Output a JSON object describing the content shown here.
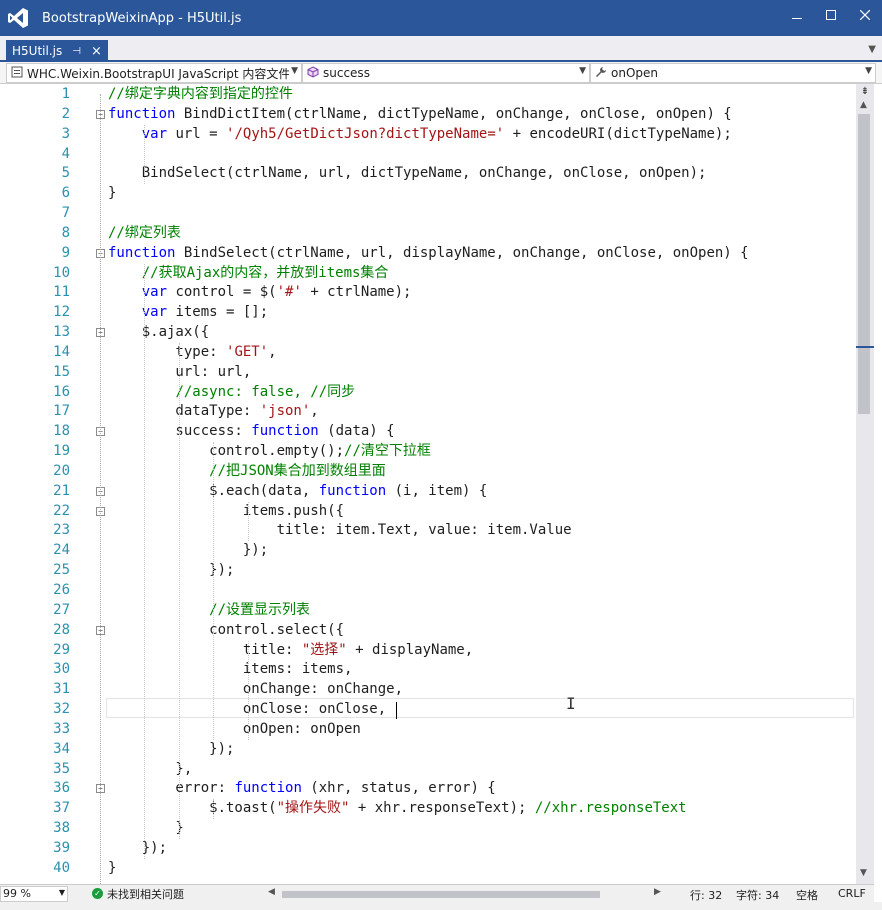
{
  "window": {
    "title": "BootstrapWeixinApp - H5Util.js",
    "colors": {
      "titlebar": "#2b579a",
      "keyword": "#0000ff",
      "string": "#a31515",
      "comment": "#008000",
      "linenum": "#2b91af"
    }
  },
  "tab": {
    "label": "H5Util.js",
    "pin_glyph": "⊣",
    "close_glyph": "×"
  },
  "nav": {
    "project": "WHC.Weixin.BootstrapUI JavaScript 内容文件",
    "scope": "success",
    "member": "onOpen"
  },
  "code_lines": [
    [
      {
        "t": "//绑定字典内容到指定的控件",
        "c": "cm"
      }
    ],
    [
      {
        "t": "function",
        "c": "kw"
      },
      {
        "t": " BindDictItem(ctrlName, dictTypeName, onChange, onClose, onOpen) {",
        "c": ""
      }
    ],
    [
      {
        "t": "    ",
        "c": ""
      },
      {
        "t": "var",
        "c": "kw"
      },
      {
        "t": " url = ",
        "c": ""
      },
      {
        "t": "'/Qyh5/GetDictJson?dictTypeName='",
        "c": "str"
      },
      {
        "t": " + encodeURI(dictTypeName);",
        "c": ""
      }
    ],
    [],
    [
      {
        "t": "    BindSelect(ctrlName, url, dictTypeName, onChange, onClose, onOpen);",
        "c": ""
      }
    ],
    [
      {
        "t": "}",
        "c": ""
      }
    ],
    [],
    [
      {
        "t": "//绑定列表",
        "c": "cm"
      }
    ],
    [
      {
        "t": "function",
        "c": "kw"
      },
      {
        "t": " BindSelect(ctrlName, url, displayName, onChange, onClose, onOpen) {",
        "c": ""
      }
    ],
    [
      {
        "t": "    ",
        "c": ""
      },
      {
        "t": "//获取Ajax的内容，并放到items集合",
        "c": "cm"
      }
    ],
    [
      {
        "t": "    ",
        "c": ""
      },
      {
        "t": "var",
        "c": "kw"
      },
      {
        "t": " control = $(",
        "c": ""
      },
      {
        "t": "'#'",
        "c": "str"
      },
      {
        "t": " + ctrlName);",
        "c": ""
      }
    ],
    [
      {
        "t": "    ",
        "c": ""
      },
      {
        "t": "var",
        "c": "kw"
      },
      {
        "t": " items = [];",
        "c": ""
      }
    ],
    [
      {
        "t": "    $.ajax({",
        "c": ""
      }
    ],
    [
      {
        "t": "        type: ",
        "c": ""
      },
      {
        "t": "'GET'",
        "c": "str"
      },
      {
        "t": ",",
        "c": ""
      }
    ],
    [
      {
        "t": "        url: url,",
        "c": ""
      }
    ],
    [
      {
        "t": "        ",
        "c": ""
      },
      {
        "t": "//async: false, //同步",
        "c": "cm"
      }
    ],
    [
      {
        "t": "        dataType: ",
        "c": ""
      },
      {
        "t": "'json'",
        "c": "str"
      },
      {
        "t": ",",
        "c": ""
      }
    ],
    [
      {
        "t": "        success: ",
        "c": ""
      },
      {
        "t": "function",
        "c": "kw"
      },
      {
        "t": " (data) {",
        "c": ""
      }
    ],
    [
      {
        "t": "            control.empty();",
        "c": ""
      },
      {
        "t": "//清空下拉框",
        "c": "cm"
      }
    ],
    [
      {
        "t": "            ",
        "c": ""
      },
      {
        "t": "//把JSON集合加到数组里面",
        "c": "cm"
      }
    ],
    [
      {
        "t": "            $.each(data, ",
        "c": ""
      },
      {
        "t": "function",
        "c": "kw"
      },
      {
        "t": " (i, item) {",
        "c": ""
      }
    ],
    [
      {
        "t": "                items.push({",
        "c": ""
      }
    ],
    [
      {
        "t": "                    title: item.Text, value: item.Value",
        "c": ""
      }
    ],
    [
      {
        "t": "                });",
        "c": ""
      }
    ],
    [
      {
        "t": "            });",
        "c": ""
      }
    ],
    [],
    [
      {
        "t": "            ",
        "c": ""
      },
      {
        "t": "//设置显示列表",
        "c": "cm"
      }
    ],
    [
      {
        "t": "            control.select({",
        "c": ""
      }
    ],
    [
      {
        "t": "                title: ",
        "c": ""
      },
      {
        "t": "\"选择\"",
        "c": "str"
      },
      {
        "t": " + displayName,",
        "c": ""
      }
    ],
    [
      {
        "t": "                items: items,",
        "c": ""
      }
    ],
    [
      {
        "t": "                onChange: onChange,",
        "c": ""
      }
    ],
    [
      {
        "t": "                onClose: onClose,",
        "c": ""
      }
    ],
    [
      {
        "t": "                onOpen: onOpen",
        "c": ""
      }
    ],
    [
      {
        "t": "            });",
        "c": ""
      }
    ],
    [
      {
        "t": "        },",
        "c": ""
      }
    ],
    [
      {
        "t": "        error: ",
        "c": ""
      },
      {
        "t": "function",
        "c": "kw"
      },
      {
        "t": " (xhr, status, error) {",
        "c": ""
      }
    ],
    [
      {
        "t": "            $.toast(",
        "c": ""
      },
      {
        "t": "\"操作失败\"",
        "c": "str"
      },
      {
        "t": " + xhr.responseText); ",
        "c": ""
      },
      {
        "t": "//xhr.responseText",
        "c": "cm"
      }
    ],
    [
      {
        "t": "        }",
        "c": ""
      }
    ],
    [
      {
        "t": "    });",
        "c": ""
      }
    ],
    [
      {
        "t": "}",
        "c": ""
      }
    ]
  ],
  "fold_lines": [
    2,
    9,
    13,
    18,
    21,
    22,
    28,
    36
  ],
  "status": {
    "zoom": "99 %",
    "issues": "未找到相关问题",
    "line": "行: 32",
    "col": "字符: 34",
    "space": "空格",
    "eol": "CRLF"
  }
}
